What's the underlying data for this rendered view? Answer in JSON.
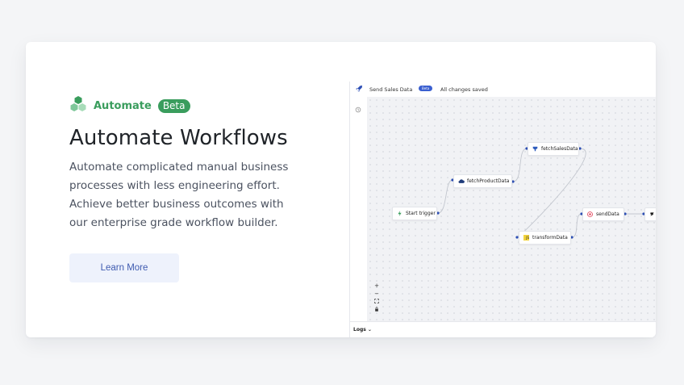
{
  "brand": {
    "name": "Automate",
    "badge": "Beta",
    "brand_color": "#3a9d5d"
  },
  "hero": {
    "title": "Automate Workflows",
    "description": "Automate complicated manual business processes with less engineering effort. Achieve better business outcomes with our enterprise grade workflow builder.",
    "cta_label": "Learn More"
  },
  "app": {
    "flow_name": "Send Sales Data",
    "beta_badge": "Beta",
    "status": "All changes saved",
    "logs_label": "Logs ⌄",
    "zoom_controls": [
      "+",
      "−",
      "⛶",
      "🔒"
    ],
    "nodes": {
      "start": {
        "label": "Start trigger",
        "icon": "lightning-icon"
      },
      "fetch_product": {
        "label": "fetchProductData",
        "icon": "cloud-icon"
      },
      "fetch_sales": {
        "label": "fetchSalesData",
        "icon": "database-icon"
      },
      "transform": {
        "label": "transformData",
        "icon": "js-icon"
      },
      "send": {
        "label": "sendData",
        "icon": "target-icon"
      },
      "partial": {
        "label": "",
        "icon": "stripe-icon"
      }
    }
  }
}
